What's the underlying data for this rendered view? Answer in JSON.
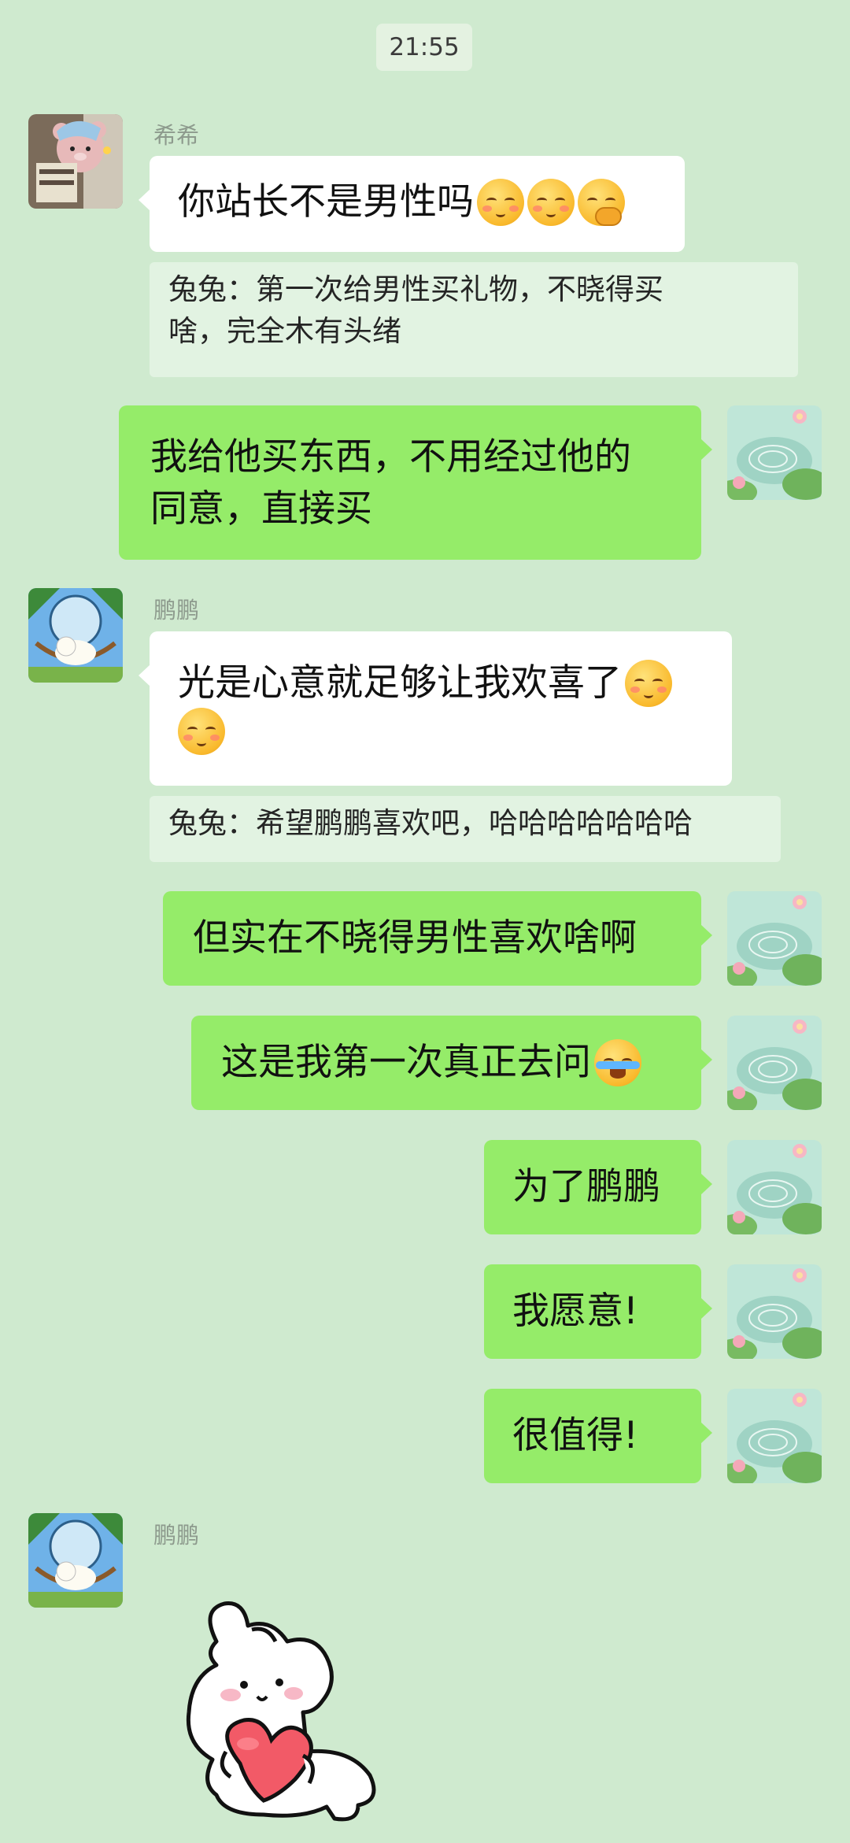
{
  "chat": {
    "time": "21:55",
    "senders": {
      "xixi": "希希",
      "pengpeng": "鹏鹏"
    },
    "messages": [
      {
        "id": "m1",
        "text": "你站长不是男性吗"
      },
      {
        "id": "q1",
        "text": "兔兔：第一次给男性买礼物，不晓得买\n啥，完全木有头绪"
      },
      {
        "id": "m2",
        "text": "我给他买东西，不用经过他的\n同意，直接买"
      },
      {
        "id": "m3",
        "text": "光是心意就足够让我欢喜了"
      },
      {
        "id": "q2",
        "text": "兔兔：希望鹏鹏喜欢吧，哈哈哈哈哈哈哈"
      },
      {
        "id": "m4",
        "text": "但实在不晓得男性喜欢啥啊"
      },
      {
        "id": "m5",
        "text": "这是我第一次真正去问"
      },
      {
        "id": "m6",
        "text": "为了鹏鹏"
      },
      {
        "id": "m7",
        "text": "我愿意!"
      },
      {
        "id": "m8",
        "text": "很值得!"
      }
    ]
  },
  "icons": {
    "avatar_xixi": "bear-plush-avatar",
    "avatar_pengpeng": "sheep-hammock-avatar",
    "avatar_self": "lotus-pond-avatar",
    "emoji_blush": "blushing-face-emoji",
    "emoji_think": "hand-over-mouth-emoji",
    "emoji_cry": "laughing-crying-emoji",
    "sticker": "puppy-holding-heart-sticker"
  },
  "colors": {
    "background": "#cfeacf",
    "outgoing_bubble": "#95ec69",
    "incoming_bubble": "#ffffff",
    "quote_bg": "#e2f3e2",
    "sender_name": "#8d9a8d"
  }
}
